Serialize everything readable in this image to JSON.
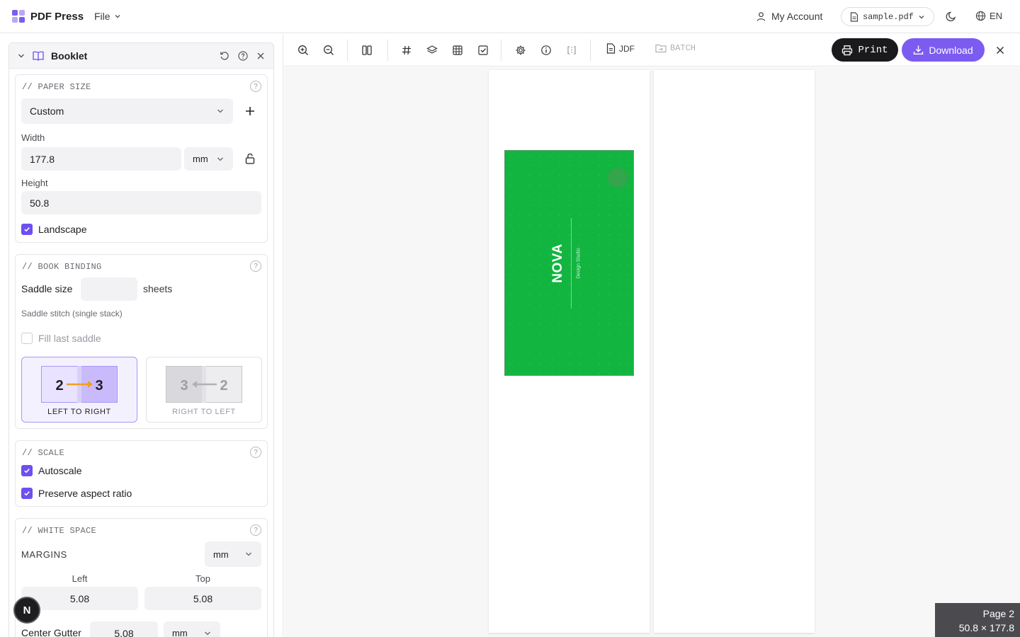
{
  "header": {
    "brand": "PDF Press",
    "file_menu": "File",
    "account": "My Account",
    "file_name": "sample.pdf",
    "language": "EN"
  },
  "panel": {
    "title": "Booklet",
    "paper_size": {
      "title": "// PAPER SIZE",
      "preset": "Custom",
      "width_label": "Width",
      "width": "177.8",
      "unit": "mm",
      "height_label": "Height",
      "height": "50.8",
      "landscape_label": "Landscape",
      "landscape": true
    },
    "binding": {
      "title": "// BOOK BINDING",
      "saddle_label": "Saddle size",
      "saddle_value": "",
      "saddle_unit": "sheets",
      "note": "Saddle stitch (single stack)",
      "fill_label": "Fill last saddle",
      "fill": false,
      "ltr_label": "LEFT TO RIGHT",
      "rtl_label": "RIGHT TO LEFT",
      "ltr_a": "2",
      "ltr_b": "3",
      "rtl_a": "3",
      "rtl_b": "2",
      "selected": "ltr"
    },
    "scale": {
      "title": "// SCALE",
      "autoscale_label": "Autoscale",
      "autoscale": true,
      "aspect_label": "Preserve aspect ratio",
      "aspect": true
    },
    "white_space": {
      "title": "// WHITE SPACE",
      "margins_label": "MARGINS",
      "margins_unit": "mm",
      "left_label": "Left",
      "left": "5.08",
      "top_label": "Top",
      "top": "5.08",
      "gutter_label": "Center Gutter",
      "gutter": "5.08",
      "gutter_unit": "mm"
    }
  },
  "toolbar": {
    "jdf": "JDF",
    "batch": "BATCH",
    "print": "Print",
    "download": "Download"
  },
  "preview": {
    "brand_text": "NOVA",
    "brand_sub": "Design Studio",
    "card_color": "#12b53f",
    "page_label": "Page 2",
    "page_size": "50.8 × 177.8"
  },
  "badge": "N",
  "colors": {
    "accent": "#7c5cf0",
    "check": "#6e4ff0",
    "dark": "#1a1a1d"
  }
}
